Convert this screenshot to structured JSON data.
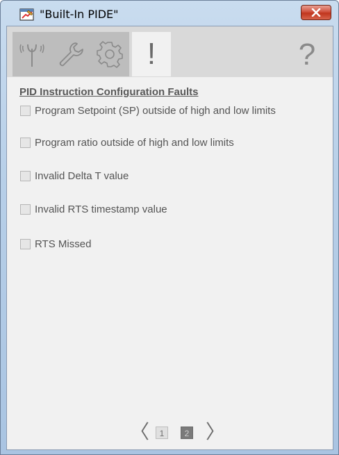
{
  "window": {
    "title": "\"Built-In PIDE\""
  },
  "tabs": [
    {
      "icon": "antenna-icon",
      "active": false
    },
    {
      "icon": "wrench-icon",
      "active": false
    },
    {
      "icon": "gear-icon",
      "active": false
    },
    {
      "icon": "exclamation-icon",
      "active": true,
      "label": "!"
    }
  ],
  "help": {
    "label": "?"
  },
  "faults": {
    "title": "PID Instruction Configuration Faults",
    "items": [
      {
        "label": "Program Setpoint (SP) outside of high and low limits",
        "checked": false
      },
      {
        "label": "Program ratio outside of high and low limits",
        "checked": false
      },
      {
        "label": "Invalid Delta T value",
        "checked": false
      },
      {
        "label": "Invalid RTS timestamp value",
        "checked": false
      },
      {
        "label": "RTS Missed",
        "checked": false
      }
    ]
  },
  "pager": {
    "prev": "〈",
    "next": "〉",
    "pages": [
      "1",
      "2"
    ],
    "current": "2"
  },
  "colors": {
    "close_button": "#c9422b",
    "tab_inactive": "#bdbdbd",
    "content_bg": "#f1f1f1",
    "text": "#545454"
  }
}
